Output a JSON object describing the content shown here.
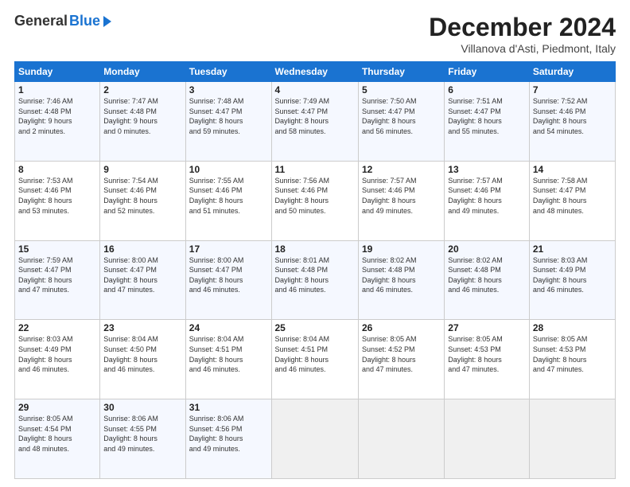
{
  "header": {
    "logo_general": "General",
    "logo_blue": "Blue",
    "month_title": "December 2024",
    "subtitle": "Villanova d'Asti, Piedmont, Italy"
  },
  "days_of_week": [
    "Sunday",
    "Monday",
    "Tuesday",
    "Wednesday",
    "Thursday",
    "Friday",
    "Saturday"
  ],
  "weeks": [
    [
      {
        "day": "1",
        "info": "Sunrise: 7:46 AM\nSunset: 4:48 PM\nDaylight: 9 hours\nand 2 minutes."
      },
      {
        "day": "2",
        "info": "Sunrise: 7:47 AM\nSunset: 4:48 PM\nDaylight: 9 hours\nand 0 minutes."
      },
      {
        "day": "3",
        "info": "Sunrise: 7:48 AM\nSunset: 4:47 PM\nDaylight: 8 hours\nand 59 minutes."
      },
      {
        "day": "4",
        "info": "Sunrise: 7:49 AM\nSunset: 4:47 PM\nDaylight: 8 hours\nand 58 minutes."
      },
      {
        "day": "5",
        "info": "Sunrise: 7:50 AM\nSunset: 4:47 PM\nDaylight: 8 hours\nand 56 minutes."
      },
      {
        "day": "6",
        "info": "Sunrise: 7:51 AM\nSunset: 4:47 PM\nDaylight: 8 hours\nand 55 minutes."
      },
      {
        "day": "7",
        "info": "Sunrise: 7:52 AM\nSunset: 4:46 PM\nDaylight: 8 hours\nand 54 minutes."
      }
    ],
    [
      {
        "day": "8",
        "info": "Sunrise: 7:53 AM\nSunset: 4:46 PM\nDaylight: 8 hours\nand 53 minutes."
      },
      {
        "day": "9",
        "info": "Sunrise: 7:54 AM\nSunset: 4:46 PM\nDaylight: 8 hours\nand 52 minutes."
      },
      {
        "day": "10",
        "info": "Sunrise: 7:55 AM\nSunset: 4:46 PM\nDaylight: 8 hours\nand 51 minutes."
      },
      {
        "day": "11",
        "info": "Sunrise: 7:56 AM\nSunset: 4:46 PM\nDaylight: 8 hours\nand 50 minutes."
      },
      {
        "day": "12",
        "info": "Sunrise: 7:57 AM\nSunset: 4:46 PM\nDaylight: 8 hours\nand 49 minutes."
      },
      {
        "day": "13",
        "info": "Sunrise: 7:57 AM\nSunset: 4:46 PM\nDaylight: 8 hours\nand 49 minutes."
      },
      {
        "day": "14",
        "info": "Sunrise: 7:58 AM\nSunset: 4:47 PM\nDaylight: 8 hours\nand 48 minutes."
      }
    ],
    [
      {
        "day": "15",
        "info": "Sunrise: 7:59 AM\nSunset: 4:47 PM\nDaylight: 8 hours\nand 47 minutes."
      },
      {
        "day": "16",
        "info": "Sunrise: 8:00 AM\nSunset: 4:47 PM\nDaylight: 8 hours\nand 47 minutes."
      },
      {
        "day": "17",
        "info": "Sunrise: 8:00 AM\nSunset: 4:47 PM\nDaylight: 8 hours\nand 46 minutes."
      },
      {
        "day": "18",
        "info": "Sunrise: 8:01 AM\nSunset: 4:48 PM\nDaylight: 8 hours\nand 46 minutes."
      },
      {
        "day": "19",
        "info": "Sunrise: 8:02 AM\nSunset: 4:48 PM\nDaylight: 8 hours\nand 46 minutes."
      },
      {
        "day": "20",
        "info": "Sunrise: 8:02 AM\nSunset: 4:48 PM\nDaylight: 8 hours\nand 46 minutes."
      },
      {
        "day": "21",
        "info": "Sunrise: 8:03 AM\nSunset: 4:49 PM\nDaylight: 8 hours\nand 46 minutes."
      }
    ],
    [
      {
        "day": "22",
        "info": "Sunrise: 8:03 AM\nSunset: 4:49 PM\nDaylight: 8 hours\nand 46 minutes."
      },
      {
        "day": "23",
        "info": "Sunrise: 8:04 AM\nSunset: 4:50 PM\nDaylight: 8 hours\nand 46 minutes."
      },
      {
        "day": "24",
        "info": "Sunrise: 8:04 AM\nSunset: 4:51 PM\nDaylight: 8 hours\nand 46 minutes."
      },
      {
        "day": "25",
        "info": "Sunrise: 8:04 AM\nSunset: 4:51 PM\nDaylight: 8 hours\nand 46 minutes."
      },
      {
        "day": "26",
        "info": "Sunrise: 8:05 AM\nSunset: 4:52 PM\nDaylight: 8 hours\nand 47 minutes."
      },
      {
        "day": "27",
        "info": "Sunrise: 8:05 AM\nSunset: 4:53 PM\nDaylight: 8 hours\nand 47 minutes."
      },
      {
        "day": "28",
        "info": "Sunrise: 8:05 AM\nSunset: 4:53 PM\nDaylight: 8 hours\nand 47 minutes."
      }
    ],
    [
      {
        "day": "29",
        "info": "Sunrise: 8:05 AM\nSunset: 4:54 PM\nDaylight: 8 hours\nand 48 minutes."
      },
      {
        "day": "30",
        "info": "Sunrise: 8:06 AM\nSunset: 4:55 PM\nDaylight: 8 hours\nand 49 minutes."
      },
      {
        "day": "31",
        "info": "Sunrise: 8:06 AM\nSunset: 4:56 PM\nDaylight: 8 hours\nand 49 minutes."
      },
      {
        "day": "",
        "info": ""
      },
      {
        "day": "",
        "info": ""
      },
      {
        "day": "",
        "info": ""
      },
      {
        "day": "",
        "info": ""
      }
    ]
  ]
}
